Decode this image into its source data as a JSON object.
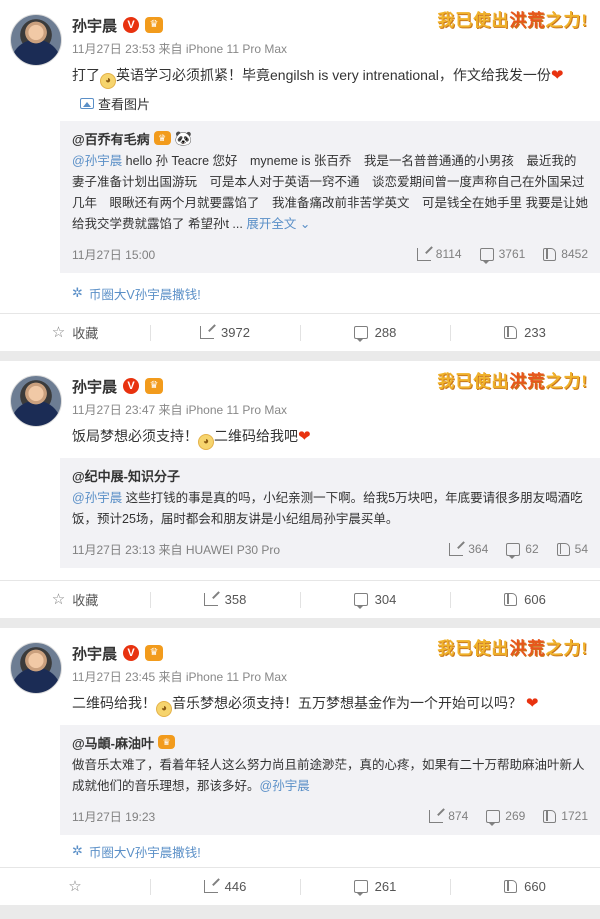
{
  "colors": {
    "accent": "#eb7350",
    "mention": "#5a8fc7",
    "verified": "#e8320f",
    "badge": "#f29b1c"
  },
  "slogan": {
    "prefix": "我已使出",
    "highlight": "洪荒",
    "suffix": "之力!"
  },
  "posts": [
    {
      "author": "孙宇晨",
      "verified_icon": "v-verified-icon",
      "meta": "11月27日 23:53 来自 iPhone 11 Pro Max",
      "text_parts": [
        "打了",
        "英语学习必须抓紧！毕竟engilsh is very intrenational，作文给我发一份"
      ],
      "view_pics": "查看图片",
      "repost": {
        "author": "@百乔有毛病",
        "mention": "@孙宇晨",
        "body": " hello 孙 Teacre 您好　myneme is 张百乔　我是一名普普通通的小男孩　最近我的妻子准备计划出国游玩　可是本人对于英语一窍不通　谈恋爱期间曾一度声称自己在外国呆过几年　眼瞅还有两个月就要露馅了　我准备痛改前非苦学英文　可是钱全在她手里 我要是让她给我交学费就露馅了 希望孙t ...",
        "expand": "展开全文",
        "time": "11月27日 15:00",
        "reposts": "8114",
        "comments": "3761",
        "likes": "8452"
      },
      "source": "币圈大V孙宇晨撒钱!",
      "actions": {
        "favorite": "收藏",
        "share": "3972",
        "comment": "288",
        "like": "233"
      }
    },
    {
      "author": "孙宇晨",
      "verified_icon": "v-verified-icon",
      "meta": "11月27日 23:47 来自 iPhone 11 Pro Max",
      "text_parts": [
        "饭局梦想必须支持！",
        "二维码给我吧"
      ],
      "repost": {
        "author": "@纪中展-知识分子",
        "mention": "@孙宇晨",
        "body": " 这些打钱的事是真的吗，小纪亲测一下啊。给我5万块吧，年底要请很多朋友喝酒吃饭，预计25场，届时都会和朋友讲是小纪组局孙宇晨买单。",
        "time": "11月27日 23:13 来自 HUAWEI P30 Pro",
        "reposts": "364",
        "comments": "62",
        "likes": "54"
      },
      "actions": {
        "favorite": "收藏",
        "share": "358",
        "comment": "304",
        "like": "606"
      }
    },
    {
      "author": "孙宇晨",
      "verified_icon": "v-verified-icon",
      "meta": "11月27日 23:45 来自 iPhone 11 Pro Max",
      "text_parts": [
        "二维码给我！",
        "音乐梦想必须支持！五万梦想基金作为一个开始可以吗？"
      ],
      "repost": {
        "author": "@马頔-麻油叶",
        "body": "做音乐太难了，看着年轻人这么努力尚且前途渺茫，真的心疼，如果有二十万帮助麻油叶新人成就他们的音乐理想，那该多好。",
        "mention_end": "@孙宇晨",
        "time": "11月27日 19:23",
        "reposts": "874",
        "comments": "269",
        "likes": "1721"
      },
      "source": "币圈大V孙宇晨撒钱!",
      "actions": {
        "share": "446",
        "comment": "261",
        "like": "660"
      }
    }
  ]
}
